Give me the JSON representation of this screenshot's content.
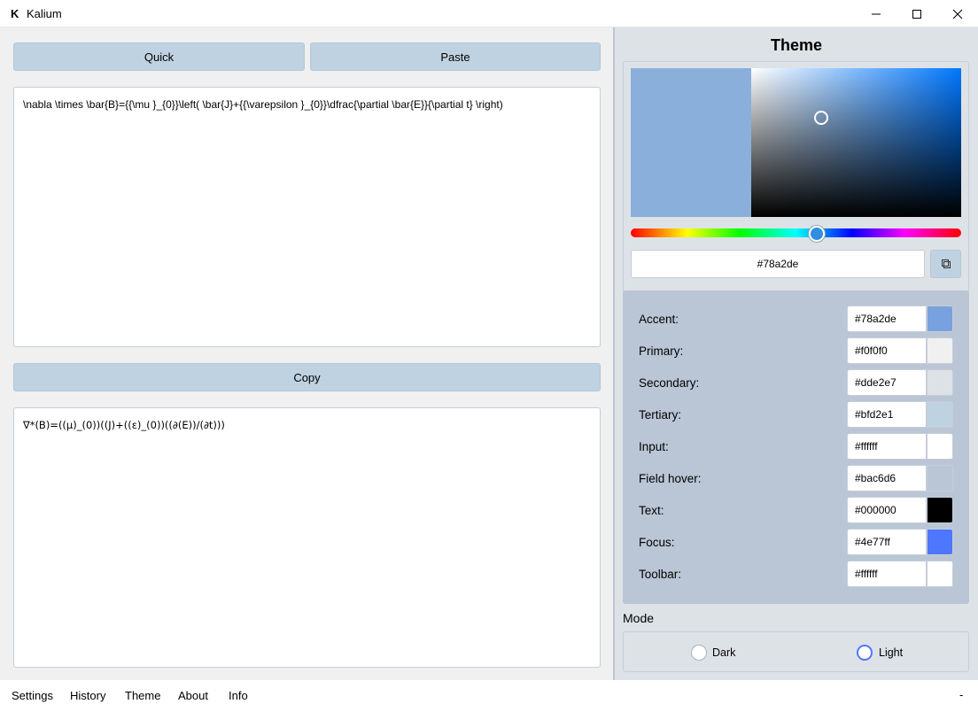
{
  "window": {
    "app_icon": "K",
    "title": "Kalium"
  },
  "input_panel": {
    "quick_label": "Quick",
    "paste_label": "Paste",
    "latex_input": "\\nabla \\times \\bar{B}={{\\mu }_{0}}\\left( \\bar{J}+{{\\varepsilon }_{0}}\\dfrac{\\partial \\bar{E}}{\\partial t} \\right)",
    "copy_label": "Copy",
    "output": "∇*(B)=((μ)_(0))((J)+((ε)_(0))((∂(E))/(∂t)))"
  },
  "theme_panel": {
    "title": "Theme",
    "picker": {
      "hex_value": "#78a2de",
      "hue_color": "#0077ff",
      "swatch_color": "#8aafdb",
      "copy_icon": "copy-icon"
    },
    "colors": [
      {
        "label": "Accent:",
        "value": "#78a2de",
        "swatch": "#78a2de"
      },
      {
        "label": "Primary:",
        "value": "#f0f0f0",
        "swatch": "#f0f0f0"
      },
      {
        "label": "Secondary:",
        "value": "#dde2e7",
        "swatch": "#dde2e7"
      },
      {
        "label": "Tertiary:",
        "value": "#bfd2e1",
        "swatch": "#bfd2e1"
      },
      {
        "label": "Input:",
        "value": "#ffffff",
        "swatch": "#ffffff"
      },
      {
        "label": "Field hover:",
        "value": "#bac6d6",
        "swatch": "#bac6d6"
      },
      {
        "label": "Text:",
        "value": "#000000",
        "swatch": "#000000"
      },
      {
        "label": "Focus:",
        "value": "#4e77ff",
        "swatch": "#4e77ff"
      },
      {
        "label": "Toolbar:",
        "value": "#ffffff",
        "swatch": "#ffffff"
      }
    ],
    "mode_label": "Mode",
    "mode_options": [
      {
        "label": "Dark",
        "checked": false
      },
      {
        "label": "Light",
        "checked": true
      }
    ]
  },
  "nav": {
    "items": [
      "Settings",
      "History",
      "Theme",
      "About",
      "Info"
    ],
    "trailing": "-"
  }
}
